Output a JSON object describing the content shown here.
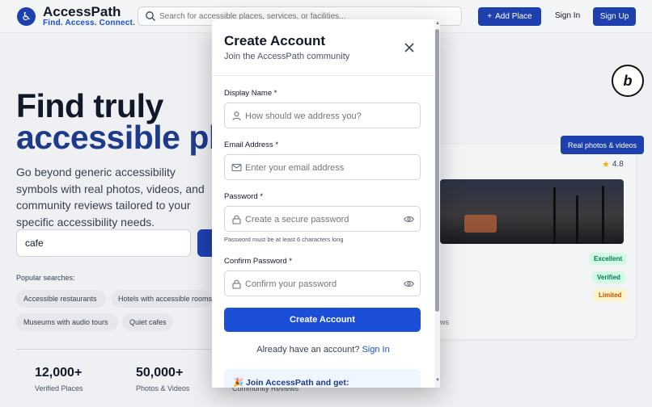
{
  "header": {
    "brand_name": "AccessPath",
    "tagline": "Find. Access. Connect.",
    "search_placeholder": "Search for accessible places, services, or facilities...",
    "add_place_label": "Add Place",
    "signin_label": "Sign In",
    "signup_label": "Sign Up"
  },
  "hero": {
    "title_line1": "Find truly",
    "title_line2": "accessible pl",
    "subtitle": "Go beyond generic accessibility symbols with real photos, videos, and community reviews tailored to your specific accessibility needs.",
    "search_value": "cafe",
    "popular_label": "Popular searches:",
    "popular": [
      "Accessible restaurants",
      "Hotels with accessible rooms",
      "Museums with audio tours",
      "Quiet cafes"
    ]
  },
  "stats": [
    {
      "value": "12,000+",
      "label": "Verified Places"
    },
    {
      "value": "50,000+",
      "label": "Photos & Videos"
    },
    {
      "value": "",
      "label": "Community Reviews"
    }
  ],
  "card": {
    "pill_label": "Real photos & videos",
    "rating": "4.8",
    "badges": [
      "Excellent",
      "Verified",
      "Limited"
    ],
    "fragment": "ws"
  },
  "modal": {
    "title": "Create Account",
    "subtitle": "Join the AccessPath community",
    "fields": {
      "display_name": {
        "label": "Display Name *",
        "placeholder": "How should we address you?"
      },
      "email": {
        "label": "Email Address *",
        "placeholder": "Enter your email address"
      },
      "password": {
        "label": "Password *",
        "placeholder": "Create a secure password",
        "hint": "Password must be at least 6 characters long"
      },
      "confirm": {
        "label": "Confirm Password *",
        "placeholder": "Confirm your password"
      }
    },
    "submit_label": "Create Account",
    "have_account_text": "Already have an account?",
    "signin_link": "Sign In",
    "promo_text": "🎉 Join AccessPath and get:"
  },
  "colors": {
    "primary": "#1e40af",
    "primary_bright": "#1d4ed8",
    "accent_star": "#eab308"
  }
}
